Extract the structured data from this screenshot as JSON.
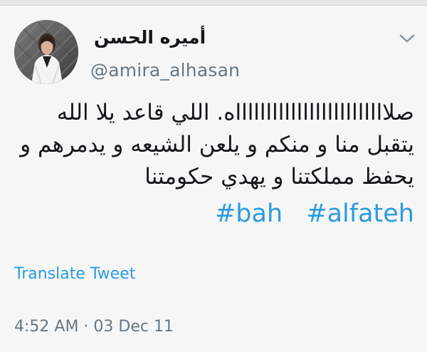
{
  "tweet": {
    "author": {
      "display_name": "أميره الحسن",
      "handle": "@amira_alhasan"
    },
    "text": "صلاااااااااااااااااااااااااه. اللي قاعد يلا الله يتقبل منا و منكم و يلعن الشيعه و يدمرهم و يحفظ مملكتنا و يهدي حكومتنا",
    "hashtags": [
      "#bah",
      "#alfateh"
    ],
    "translate_label": "Translate Tweet",
    "time": "4:52 AM",
    "separator": " · ",
    "date": "03 Dec 11"
  },
  "icons": {
    "menu": "chevron-down-icon",
    "avatar": "avatar-image"
  },
  "colors": {
    "link": "#2b9be0",
    "text": "#14171a",
    "secondary": "#657786",
    "background": "#f6f6f6"
  }
}
